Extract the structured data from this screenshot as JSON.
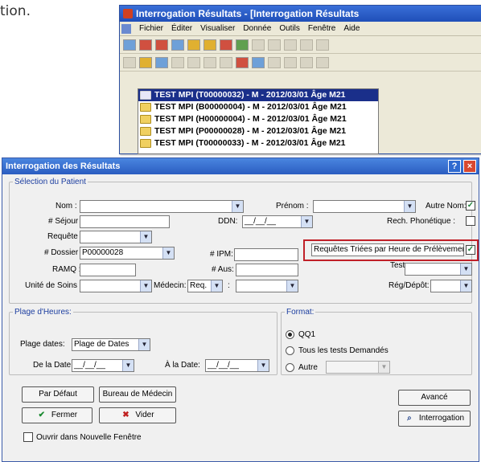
{
  "caption": "tion.",
  "win1": {
    "title": "Interrogation Résultats - [Interrogation Résultats",
    "menu": [
      "Fichier",
      "Éditer",
      "Visualiser",
      "Donnée",
      "Outils",
      "Fenêtre",
      "Aide"
    ],
    "items": [
      "TEST MPI (T00000032) - M - 2012/03/01 Âge M21",
      "TEST MPI (B00000004) - M - 2012/03/01 Âge M21",
      "TEST MPI (H00000004) - M - 2012/03/01 Âge M21",
      "TEST MPI (P00000028) - M - 2012/03/01 Âge M21",
      "TEST MPI (T00000033) - M - 2012/03/01 Âge M21"
    ],
    "tb1_icons": [
      "new-icon",
      "recent-icon",
      "patient-search-icon",
      "wizard-icon",
      "link-icon",
      "unlink-icon",
      "notes-icon",
      "alert-icon",
      "grid-icon",
      "tree-icon",
      "chart-icon",
      "stats-icon",
      "print-icon"
    ],
    "tb2_icons": [
      "dx-icon",
      "open-icon",
      "view-icon",
      "print-icon",
      "cut-icon",
      "copy-icon",
      "paste-icon",
      "flag-icon",
      "report-icon",
      "graph-icon",
      "table-icon",
      "results-icon",
      "lab-icon"
    ]
  },
  "dialog": {
    "title": "Interrogation des Résultats",
    "help": "?",
    "close": "×",
    "patient": {
      "legend": "Sélection du Patient",
      "nom": "Nom :",
      "prenom": "Prénom :",
      "autre_nom": "Autre Nom:",
      "sejour": "# Séjour :",
      "ddn": "DDN:",
      "ddn_value": "__/__/__",
      "rech_phon": "Rech. Phonétique :",
      "requete": "Requête :",
      "dossier": "# Dossier :",
      "dossier_value": "P00000028",
      "ipm": "# IPM:",
      "req_triees": "Requêtes Triées par Heure de Prélèvement",
      "ramq": "RAMQ :",
      "aus": "# Aus:",
      "test": "Test",
      "unite": "Unité de Soins :",
      "medecin": "Médecin:",
      "medecin_value": "Req.",
      "colon": ":",
      "reg": "Rég/Dépôt:"
    },
    "plage": {
      "legend": "Plage d'Heures:",
      "plage_dates": "Plage dates:",
      "plage_value": "Plage de Dates",
      "de_la_date": "De la Date:",
      "de_value": "__/__/__",
      "a_la_date": "À la Date:",
      "a_value": "__/__/__"
    },
    "format": {
      "legend": "Format:",
      "qq1": "QQ1",
      "tous": "Tous les tests Demandés",
      "autre": "Autre"
    },
    "buttons": {
      "par_defaut": "Par Défaut",
      "bureau": "Bureau de Médecin",
      "avance": "Avancé",
      "fermer": "Fermer",
      "vider": "Vider",
      "interrogation": "Interrogation"
    },
    "ouvrir": "Ouvrir dans Nouvelle Fenêtre"
  }
}
